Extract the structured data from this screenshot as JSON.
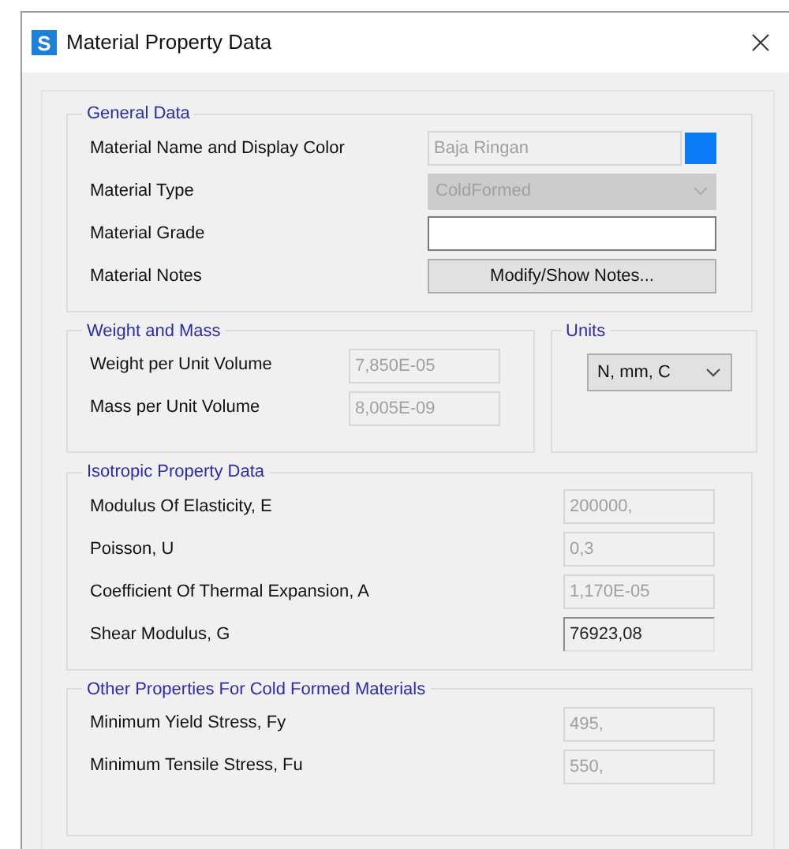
{
  "window": {
    "logo": "S",
    "title": "Material Property Data"
  },
  "general_data": {
    "title": "General Data",
    "rows": [
      {
        "label": "Material Name and Display Color",
        "kind": "text_color",
        "value": "Baja Ringan",
        "disabled": true,
        "color": "#0a7cf5"
      },
      {
        "label": "Material Type",
        "kind": "dropdown",
        "value": "ColdFormed",
        "disabled": true
      },
      {
        "label": "Material Grade",
        "kind": "text",
        "disabled": false
      },
      {
        "label": "Material Notes",
        "kind": "button",
        "button": "Modify/Show Notes..."
      }
    ]
  },
  "weight_and_mass": {
    "title": "Weight and Mass",
    "rows": [
      {
        "label": "Weight per Unit Volume",
        "kind": "text",
        "value": "7,850E-05",
        "disabled": true
      },
      {
        "label": "Mass per Unit Volume",
        "kind": "text",
        "value": "8,005E-09",
        "disabled": true
      }
    ]
  },
  "units": {
    "title": "Units",
    "value": "N, mm, C"
  },
  "isotropic_property_data": {
    "title": "Isotropic Property Data",
    "rows": [
      {
        "label": "Modulus Of Elasticity,  E",
        "kind": "text",
        "value": "200000,",
        "disabled": true
      },
      {
        "label": "Poisson, U",
        "kind": "text",
        "value": "0,3",
        "disabled": true
      },
      {
        "label": "Coefficient Of Thermal Expansion,  A",
        "kind": "text",
        "value": "1,170E-05",
        "disabled": true
      },
      {
        "label": "Shear Modulus,  G",
        "kind": "text",
        "value": "76923,08",
        "disabled": false
      }
    ]
  },
  "cold_formed_properties": {
    "title": "Other Properties For Cold Formed Materials",
    "rows": [
      {
        "label": "Minimum Yield Stress, Fy",
        "kind": "text",
        "value": "495,",
        "disabled": true
      },
      {
        "label": "Minimum Tensile Stress, Fu",
        "kind": "text",
        "value": "550,",
        "disabled": true
      }
    ]
  }
}
